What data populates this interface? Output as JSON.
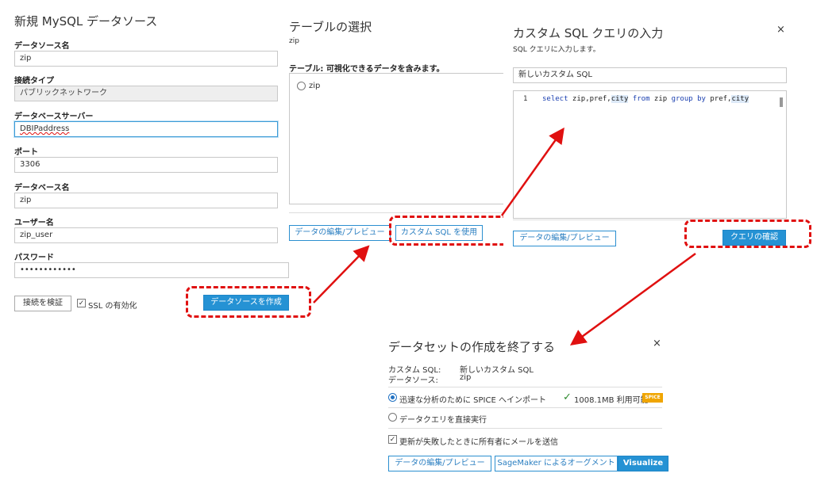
{
  "mysql": {
    "title": "新規 MySQL データソース",
    "ds_name_label": "データソース名",
    "ds_name_value": "zip",
    "conn_type_label": "接続タイプ",
    "conn_type_value": "パブリックネットワーク",
    "server_label": "データベースサーバー",
    "server_value": "DBIPaddress",
    "port_label": "ポート",
    "port_value": "3306",
    "dbname_label": "データベース名",
    "dbname_value": "zip",
    "user_label": "ユーザー名",
    "user_value": "zip_user",
    "password_label": "パスワード",
    "password_value": "••••••••••••",
    "validate_button": "接続を検証",
    "ssl_label": "SSL の有効化",
    "ssl_checked": "✓",
    "create_button": "データソースを作成"
  },
  "table": {
    "title": "テーブルの選択",
    "subtitle": "zip",
    "list_label": "テーブル: 可視化できるデータを含みます。",
    "option": "zip",
    "edit_button": "データの編集/プレビュー",
    "custom_sql_button": "カスタム SQL を使用"
  },
  "custom_sql": {
    "title": "カスタム SQL クエリの入力",
    "subtitle": "SQL クエリに入力します。",
    "close": "×",
    "name_value": "新しいカスタム SQL",
    "line_no": "1",
    "code": {
      "select": "select",
      "fields": " zip,pref,",
      "city1": "city",
      "from": " from",
      "table": " zip ",
      "group": "group",
      "by": " by",
      "pref": " pref,",
      "city2": "city"
    },
    "edit_button": "データの編集/プレビュー",
    "confirm_button": "クエリの確認"
  },
  "finish": {
    "title": "データセットの作成を終了する",
    "close": "×",
    "custom_sql_label": "カスタム SQL:",
    "custom_sql_value": "新しいカスタム SQL",
    "ds_label": "データソース:",
    "ds_value": "zip",
    "spice_option": "迅速な分析のために SPICE へインポート",
    "spice_check": "✓",
    "spice_size": "1008.1MB 利用可能",
    "spice_badge": "SPICE",
    "direct_option": "データクエリを直接実行",
    "email_checked": "✓",
    "email_label": "更新が失敗したときに所有者にメールを送信",
    "edit_button": "データの編集/プレビュー",
    "sagemaker_button": "SageMaker によるオーグメント",
    "visualize_button": "Visualize"
  },
  "colors": {
    "accent": "#2592d4",
    "annotation": "#e01010",
    "spice_badge": "#f0a500",
    "available": "#2e8b2e"
  }
}
